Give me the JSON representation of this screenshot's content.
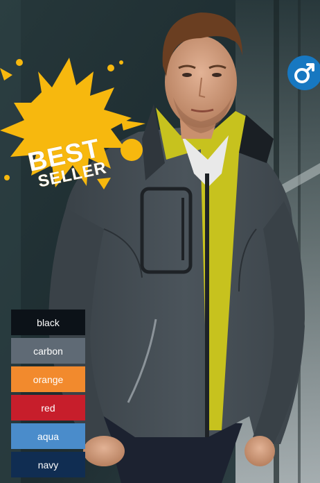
{
  "badge": {
    "line1": "BEST",
    "line2": "SELLER",
    "color": "#f7b80e"
  },
  "gender_icon": {
    "name": "male-symbol-icon",
    "color": "#1778c1"
  },
  "swatches": [
    {
      "label": "black",
      "color": "#0c1218"
    },
    {
      "label": "carbon",
      "color": "#5f6a75"
    },
    {
      "label": "orange",
      "color": "#f28a2d"
    },
    {
      "label": "red",
      "color": "#c71e2b"
    },
    {
      "label": "aqua",
      "color": "#4a8ccb"
    },
    {
      "label": "navy",
      "color": "#102d52"
    }
  ]
}
